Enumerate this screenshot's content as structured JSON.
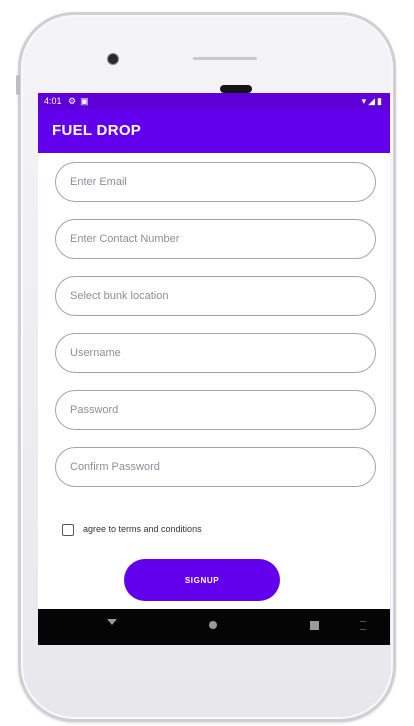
{
  "status_bar": {
    "time": "4:01",
    "left_icons": [
      "settings-icon",
      "image-icon"
    ],
    "right_icons": [
      "wifi-icon",
      "signal-icon",
      "battery-icon"
    ]
  },
  "app_bar": {
    "title": "FUEL DROP"
  },
  "form": {
    "email_placeholder": "Enter Email",
    "contact_placeholder": "Enter Contact Number",
    "bunk_placeholder": "Select bunk location",
    "username_placeholder": "Username",
    "password_placeholder": "Password",
    "confirm_password_placeholder": "Confirm Password",
    "terms_label": "agree to terms and conditions",
    "terms_checked": false,
    "signup_label": "SIGNUP"
  },
  "nav_bar": {
    "icons": [
      "back-icon",
      "home-icon",
      "recents-icon",
      "menu-icon"
    ]
  },
  "colors": {
    "accent": "#6200ee",
    "status_bar": "#5f00d9",
    "nav_bar": "#050505"
  }
}
